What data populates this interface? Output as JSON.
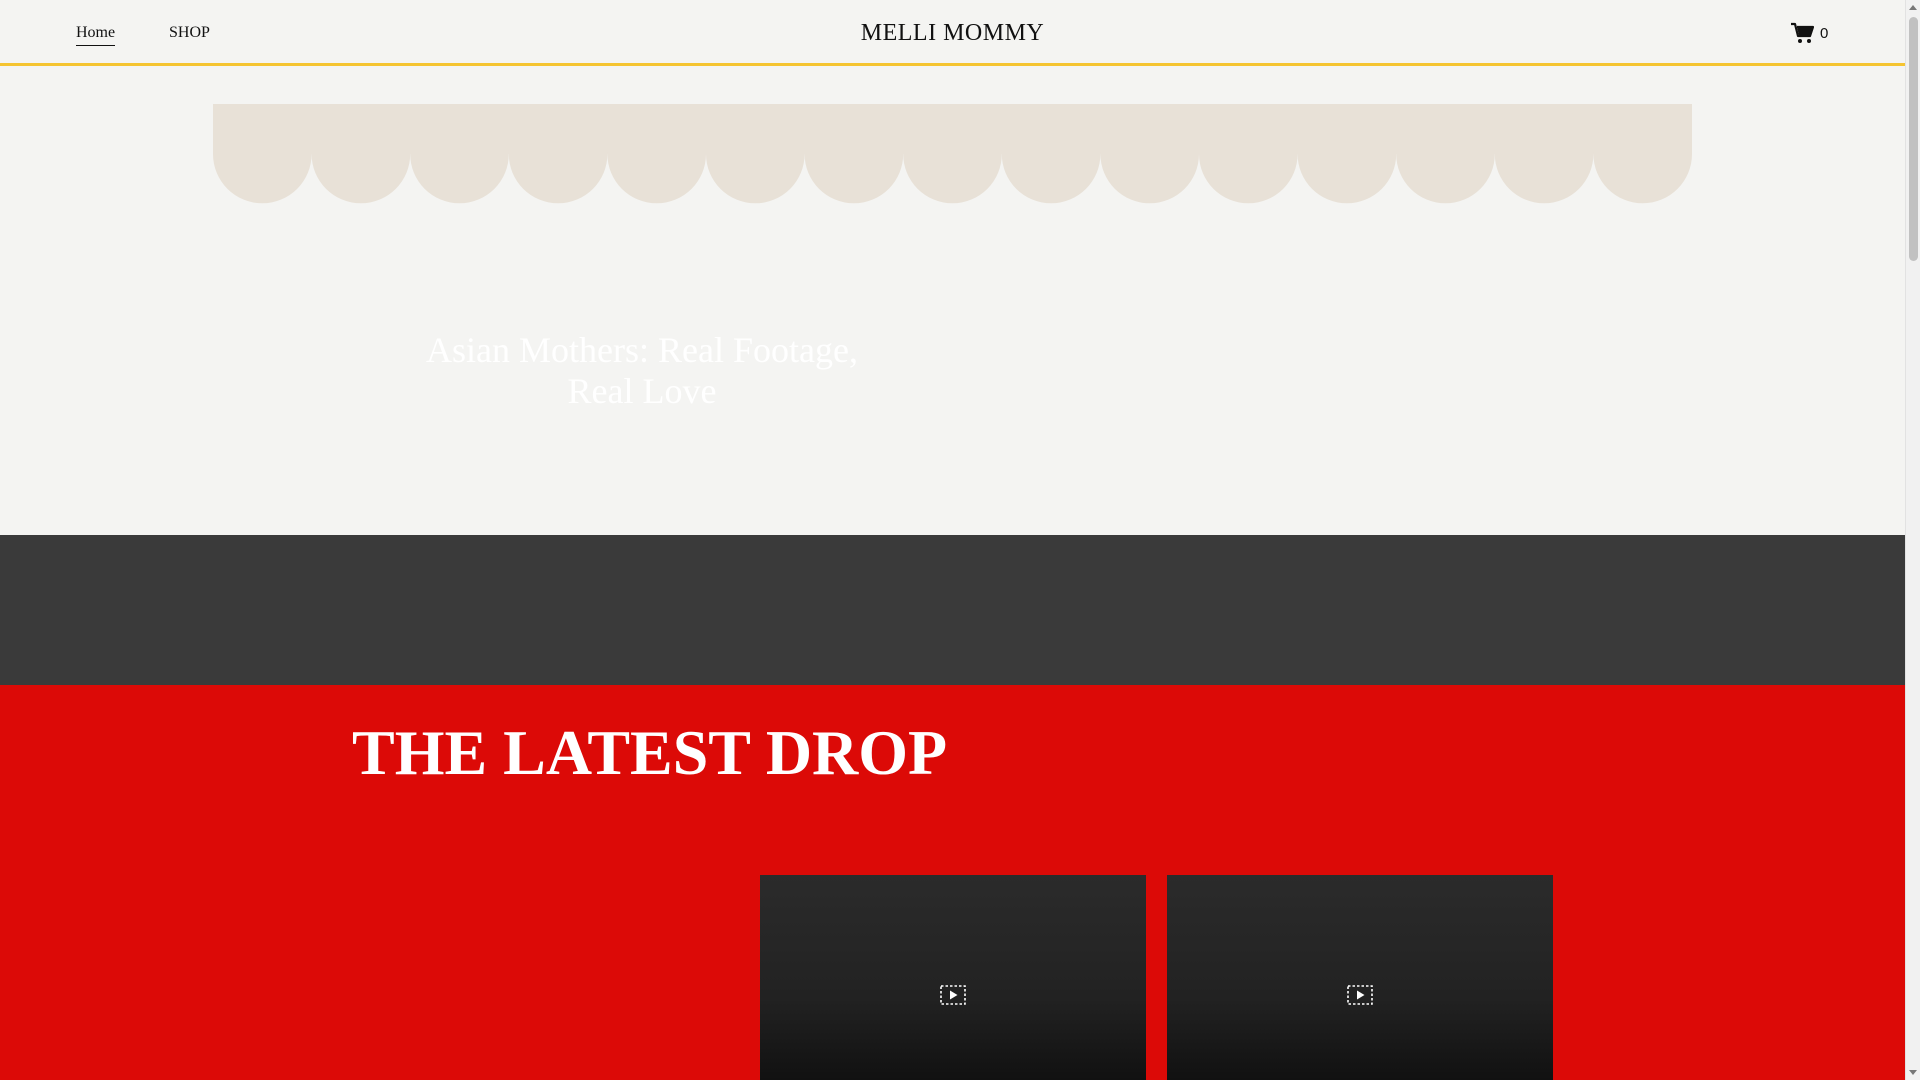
{
  "header": {
    "nav": [
      {
        "label": "Home"
      },
      {
        "label": "SHOP"
      }
    ],
    "brand": "MELLI MOMMY",
    "cart": {
      "icon": "cart-icon",
      "count": "0"
    }
  },
  "colors": {
    "header_bg": "#f4f4f2",
    "header_border": "#f5c431",
    "scallop": "#e8e1d7",
    "dark_band": "#3a3a3a",
    "red_section": "#dc0a07"
  },
  "hero": {
    "title": "Asian Mothers: Real Footage, Real Love"
  },
  "latest_drop": {
    "title": "THE LATEST DROP",
    "videos": [
      {
        "icon": "video-placeholder-icon"
      },
      {
        "icon": "video-placeholder-icon"
      }
    ]
  }
}
